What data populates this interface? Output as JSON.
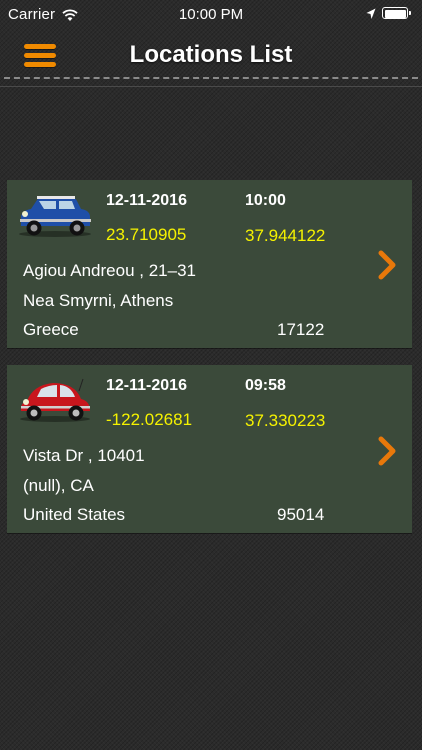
{
  "status_bar": {
    "carrier": "Carrier",
    "time": "10:00 PM",
    "icons": [
      "wifi-icon",
      "location-arrow-icon",
      "battery-icon"
    ]
  },
  "nav": {
    "title": "Locations List",
    "menu_icon": "hamburger-menu-icon",
    "accent_color": "#f08a00"
  },
  "locations": [
    {
      "car_icon": "blue-mini-car-icon",
      "date": "12-11-2016",
      "time": "10:00",
      "longitude": "23.710905",
      "latitude": "37.944122",
      "address_line1": "Agiou Andreou , 21–31",
      "address_line2": "Nea Smyrni, Athens",
      "country": "Greece",
      "postal_code": "17122"
    },
    {
      "car_icon": "red-beetle-car-icon",
      "date": "12-11-2016",
      "time": "09:58",
      "longitude": "-122.02681",
      "latitude": "37.330223",
      "address_line1": "Vista Dr , 10401",
      "address_line2": "(null), CA",
      "country": "United States",
      "postal_code": "95014"
    }
  ],
  "colors": {
    "card_bg": "#3b4a3a",
    "coordinate_text": "#f5f200",
    "chevron": "#e8780a"
  }
}
